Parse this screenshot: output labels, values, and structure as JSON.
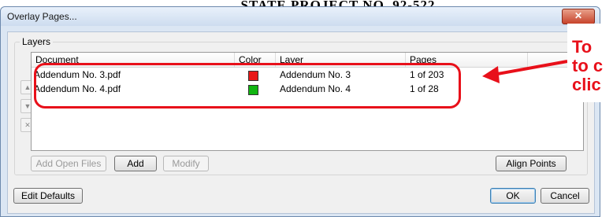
{
  "background_header": "STATE PROJECT NO. 92-522",
  "dialog": {
    "title": "Overlay Pages...",
    "close_glyph": "✕"
  },
  "layers": {
    "group_label": "Layers",
    "columns": [
      "Document",
      "Color",
      "Layer",
      "Pages"
    ],
    "rows": [
      {
        "document": "Addendum No. 3.pdf",
        "color": "#e81818",
        "layer": "Addendum No. 3",
        "pages": "1 of 203"
      },
      {
        "document": "Addendum No. 4.pdf",
        "color": "#11b511",
        "layer": "Addendum No. 4",
        "pages": "1 of 28"
      }
    ],
    "side_buttons": {
      "up_icon": "up-arrow-icon",
      "up_glyph": "▲",
      "down_icon": "down-arrow-icon",
      "down_glyph": "▼",
      "delete_icon": "delete-x-icon",
      "delete_glyph": "✕"
    }
  },
  "buttons": {
    "add_open_files": "Add Open Files",
    "add": "Add",
    "modify": "Modify",
    "align_points": "Align Points",
    "edit_defaults": "Edit Defaults",
    "ok": "OK",
    "cancel": "Cancel"
  },
  "annotation": {
    "lines": [
      "To",
      "to c",
      "clic"
    ],
    "color": "#e8101a"
  }
}
